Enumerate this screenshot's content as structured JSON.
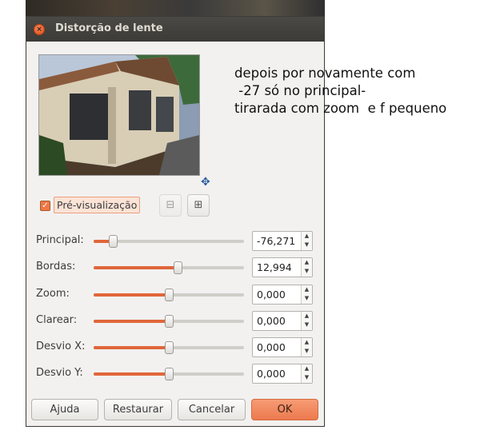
{
  "dialog": {
    "title": "Distorção de lente",
    "close_glyph": "×"
  },
  "preview": {
    "checkbox_checked": true,
    "checkbox_glyph": "✓",
    "label": "Pré-visualização",
    "move_glyph": "✥",
    "zoom_out_glyph": "⊟",
    "zoom_in_glyph": "⊞"
  },
  "params": [
    {
      "label": "Principal:",
      "value": "-76,271",
      "level": 0.13
    },
    {
      "label": "Bordas:",
      "value": "12,994",
      "level": 0.56
    },
    {
      "label": "Zoom:",
      "value": "0,000",
      "level": 0.5
    },
    {
      "label": "Clarear:",
      "value": "0,000",
      "level": 0.5
    },
    {
      "label": "Desvio X:",
      "value": "0,000",
      "level": 0.5
    },
    {
      "label": "Desvio Y:",
      "value": "0,000",
      "level": 0.5
    }
  ],
  "spin": {
    "up_glyph": "▲",
    "down_glyph": "▼"
  },
  "buttons": {
    "help": "Ajuda",
    "reset": "Restaurar",
    "cancel": "Cancelar",
    "ok": "OK"
  },
  "note": {
    "line1": "depois por novamente com",
    "line2": " -27 só no principal-",
    "line3": "tirarada com zoom  e f pequeno"
  },
  "colors": {
    "accent": "#e0663a",
    "titlebar": "#3c3b37",
    "ok_button": "#ec7a4e"
  }
}
